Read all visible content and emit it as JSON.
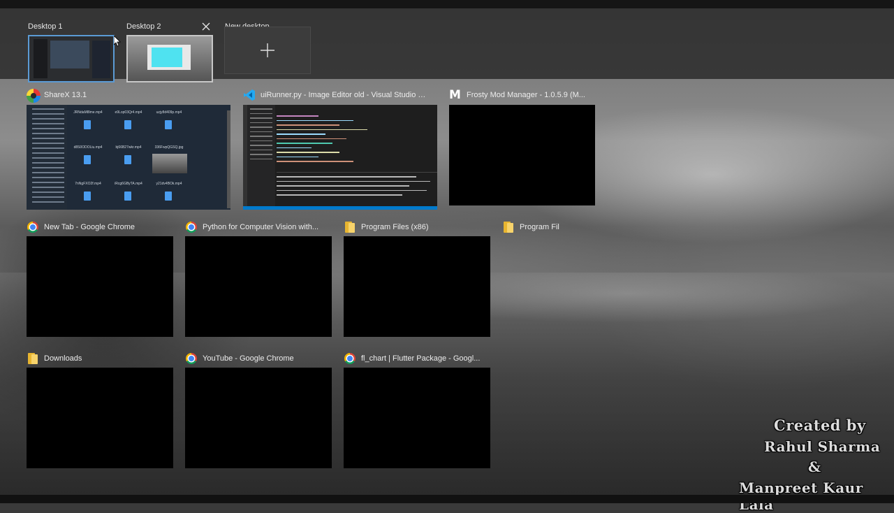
{
  "desktops": [
    {
      "label": "Desktop 1",
      "active": true
    },
    {
      "label": "Desktop 2",
      "active": false
    },
    {
      "label": "New desktop"
    }
  ],
  "windows": [
    {
      "title": "ShareX 13.1",
      "icon": "sharex-icon"
    },
    {
      "title": "uiRunner.py - Image Editor old - Visual Studio C...",
      "icon": "vscode-icon"
    },
    {
      "title": "Frosty Mod Manager - 1.0.5.9 (M...",
      "icon": "frosty-icon"
    },
    {
      "title": "New Tab - Google Chrome",
      "icon": "chrome-icon"
    },
    {
      "title": "Python for Computer Vision with...",
      "icon": "chrome-icon"
    },
    {
      "title": "Program Files (x86)",
      "icon": "folder-icon"
    },
    {
      "title": "Program Fil",
      "icon": "folder-icon"
    },
    {
      "title": "Downloads",
      "icon": "folder-icon"
    },
    {
      "title": "YouTube - Google Chrome",
      "icon": "chrome-icon"
    },
    {
      "title": "fl_chart | Flutter Package - Googl...",
      "icon": "chrome-icon"
    }
  ],
  "sharex_files": [
    "JRNdaM8lme.mp4",
    "e9Lop03Qr4.mp4",
    "uzjy8d409p.mp4",
    "d8S0ODOLiu.mp4",
    "bj66B27wkr.mp4",
    "336FwpQGSQ.jpg",
    "7nNgFXO2f.mp4",
    "iRcg6GByTA.mp4",
    "y21dv4BOk.mp4"
  ],
  "credit": {
    "line1": "Created by",
    "line2": "Rahul Sharma",
    "line3": "&",
    "line4": "Manpreet Kaur Lala"
  },
  "colors": {
    "active_desktop_border": "#5b9bd5",
    "vscode_blue": "#007acc"
  }
}
